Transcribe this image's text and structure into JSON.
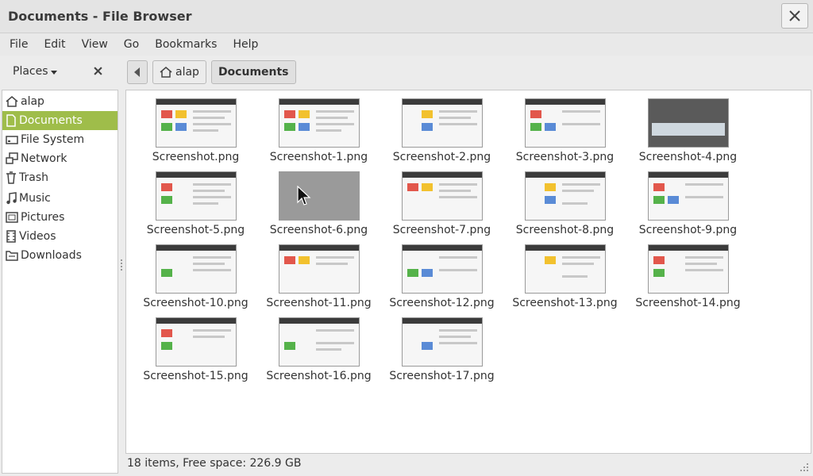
{
  "window": {
    "title": "Documents - File Browser"
  },
  "menu": [
    "File",
    "Edit",
    "View",
    "Go",
    "Bookmarks",
    "Help"
  ],
  "sidebar": {
    "header": "Places",
    "items": [
      {
        "label": "alap",
        "icon": "home-icon"
      },
      {
        "label": "Documents",
        "icon": "document-icon",
        "active": true
      },
      {
        "label": "File System",
        "icon": "drive-icon"
      },
      {
        "label": "Network",
        "icon": "network-icon"
      },
      {
        "label": "Trash",
        "icon": "trash-icon"
      },
      {
        "label": "Music",
        "icon": "music-icon"
      },
      {
        "label": "Pictures",
        "icon": "picture-icon"
      },
      {
        "label": "Videos",
        "icon": "video-icon"
      },
      {
        "label": "Downloads",
        "icon": "download-icon"
      }
    ]
  },
  "pathbar": {
    "crumbs": [
      "alap",
      "Documents"
    ]
  },
  "files": [
    "Screenshot.png",
    "Screenshot-1.png",
    "Screenshot-2.png",
    "Screenshot-3.png",
    "Screenshot-4.png",
    "Screenshot-5.png",
    "Screenshot-6.png",
    "Screenshot-7.png",
    "Screenshot-8.png",
    "Screenshot-9.png",
    "Screenshot-10.png",
    "Screenshot-11.png",
    "Screenshot-12.png",
    "Screenshot-13.png",
    "Screenshot-14.png",
    "Screenshot-15.png",
    "Screenshot-16.png",
    "Screenshot-17.png"
  ],
  "status": {
    "text": "18 items, Free space: 226.9 GB"
  },
  "colors": {
    "accent": "#9fbd4a"
  }
}
